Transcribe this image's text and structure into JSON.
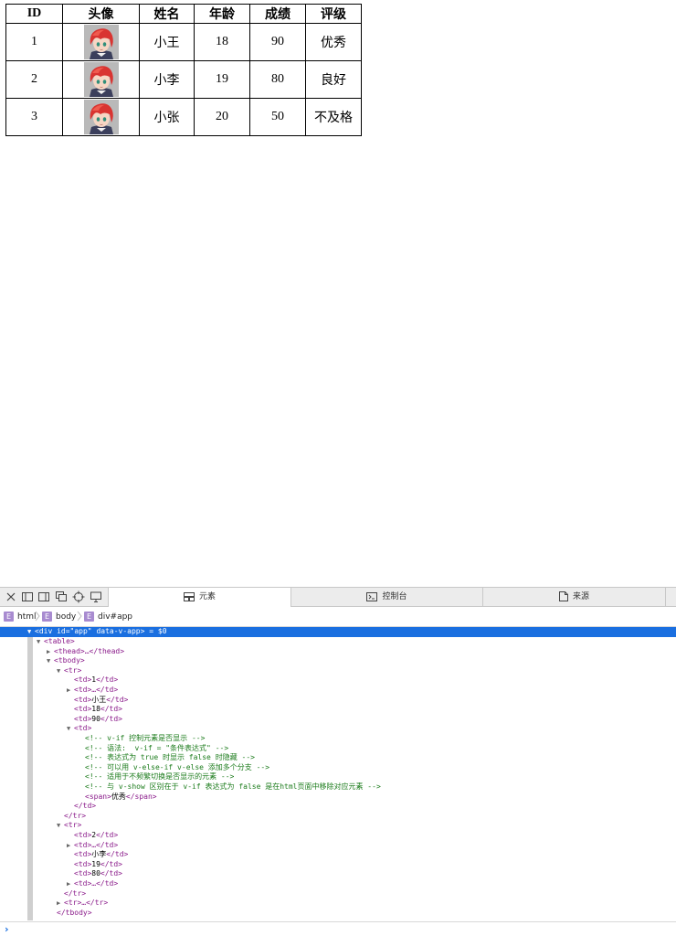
{
  "table": {
    "headers": [
      "ID",
      "头像",
      "姓名",
      "年龄",
      "成绩",
      "评级"
    ],
    "rows": [
      {
        "id": "1",
        "name": "小王",
        "age": "18",
        "score": "90",
        "grade": "优秀"
      },
      {
        "id": "2",
        "name": "小李",
        "age": "19",
        "score": "80",
        "grade": "良好"
      },
      {
        "id": "3",
        "name": "小张",
        "age": "20",
        "score": "50",
        "grade": "不及格"
      }
    ]
  },
  "devtools": {
    "tabs": [
      {
        "label": "元素",
        "icon": "elements-icon",
        "active": true
      },
      {
        "label": "控制台",
        "icon": "console-icon",
        "active": false
      },
      {
        "label": "来源",
        "icon": "sources-icon",
        "active": false
      }
    ],
    "breadcrumb": [
      "html",
      "body",
      "div#app"
    ],
    "crumb_badge": "E",
    "selection_color": "#1a6fe0",
    "dom": {
      "l0_open": "<div",
      "l0_attr1": " id=",
      "l0_val1": "\"app\"",
      "l0_attr2": " data-v-app",
      "l0_close": ">",
      "l0_ref": " = $0",
      "l1": "<table>",
      "l2": "<thead>…</thead>",
      "l3": "<tbody>",
      "tr_open": "<tr>",
      "tr_close": "</tr>",
      "td_open": "<td>",
      "td_close": "</td>",
      "td_collapsed": "<td>…</td>",
      "r1_id": "1",
      "r1_name": "小王",
      "r1_age": "18",
      "r1_score": "90",
      "comments": [
        "<!-- v-if 控制元素是否显示 -->",
        "<!-- 语法:  v-if = \"条件表达式\" -->",
        "<!-- 表达式为 true 时显示 false 时隐藏 -->",
        "<!-- 可以用 v-else-if v-else 添加多个分支 -->",
        "<!-- 适用于不频繁切换是否显示的元素 -->",
        "<!-- 与 v-show 区别在于 v-if 表达式为 false 是在html页面中移除对应元素 -->"
      ],
      "span_open": "<span>",
      "span_text": "优秀",
      "span_close": "</span>",
      "r2_id": "2",
      "r2_name": "小李",
      "r2_age": "19",
      "r2_score": "80",
      "tr_collapsed": "<tr>…</tr>",
      "tbody_close": "</tbody>"
    },
    "console_prompt": "›"
  }
}
